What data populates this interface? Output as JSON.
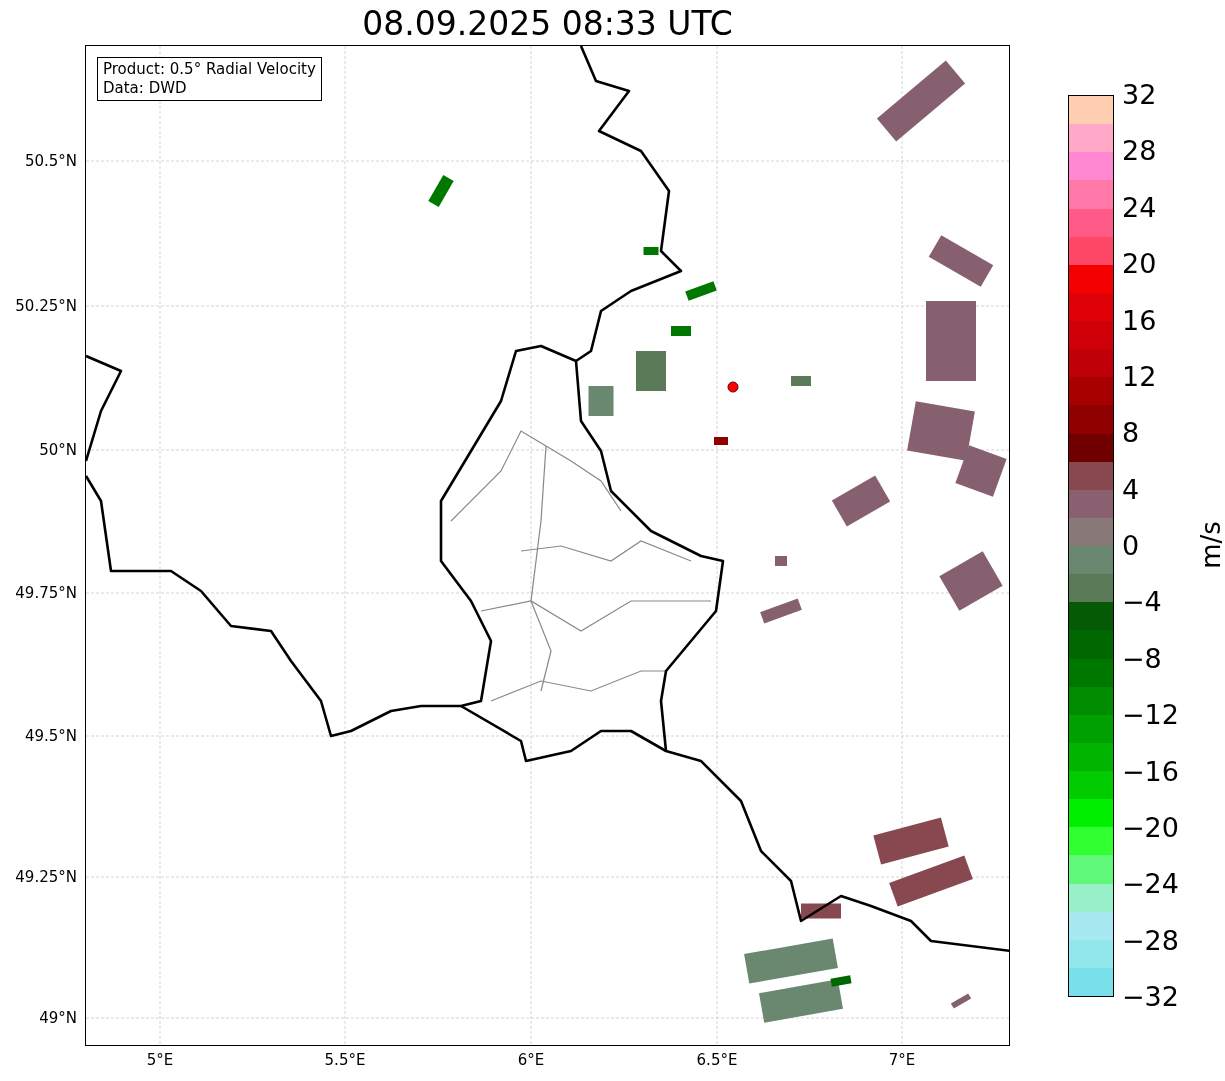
{
  "title": "08.09.2025 08:33 UTC",
  "legend": {
    "lines": [
      "Product: 0.5° Radial Velocity",
      "Data: DWD"
    ]
  },
  "y_ticks": [
    "50.5°N",
    "50.25°N",
    "50°N",
    "49.75°N",
    "49.5°N",
    "49.25°N",
    "49°N"
  ],
  "x_ticks": [
    "5°E",
    "5.5°E",
    "6°E",
    "6.5°E",
    "7°E"
  ],
  "colorbar": {
    "label": "m/s",
    "ticks": [
      "32",
      "28",
      "24",
      "20",
      "16",
      "12",
      "8",
      "4",
      "0",
      "−4",
      "−8",
      "−12",
      "−16",
      "−20",
      "−24",
      "−28",
      "−32"
    ],
    "bands": [
      {
        "color": "#ffcdb0"
      },
      {
        "color": "#ffa8c8"
      },
      {
        "color": "#ff88d0"
      },
      {
        "color": "#ff78a8"
      },
      {
        "color": "#ff5a88"
      },
      {
        "color": "#ff4868"
      },
      {
        "color": "#f50000"
      },
      {
        "color": "#e00008"
      },
      {
        "color": "#d00008"
      },
      {
        "color": "#c00008"
      },
      {
        "color": "#a80000"
      },
      {
        "color": "#900000"
      },
      {
        "color": "#700000"
      },
      {
        "color": "#884850"
      },
      {
        "color": "#886070"
      },
      {
        "color": "#887878"
      },
      {
        "color": "#6a8870"
      },
      {
        "color": "#5a7a58"
      },
      {
        "color": "#055a05"
      },
      {
        "color": "#006800"
      },
      {
        "color": "#007800"
      },
      {
        "color": "#008c00"
      },
      {
        "color": "#00a000"
      },
      {
        "color": "#00b400"
      },
      {
        "color": "#00cc00"
      },
      {
        "color": "#00f000"
      },
      {
        "color": "#30ff30"
      },
      {
        "color": "#60f878"
      },
      {
        "color": "#98f0c8"
      },
      {
        "color": "#a8e8f0"
      },
      {
        "color": "#90e8ec"
      },
      {
        "color": "#78e0e8"
      }
    ]
  }
}
